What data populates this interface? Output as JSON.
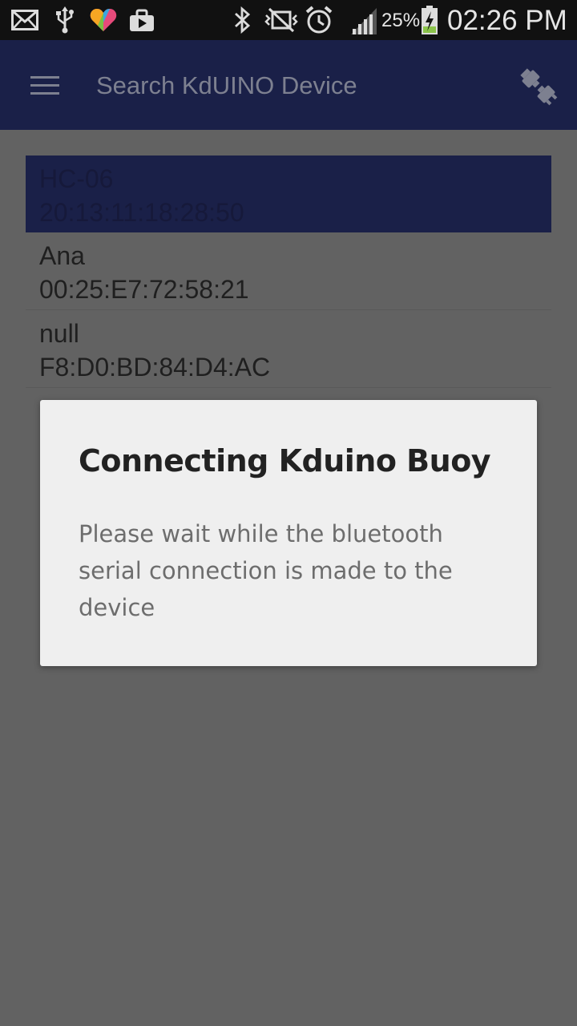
{
  "status_bar": {
    "battery_percent": "25%",
    "time": "02:26 PM",
    "icons": [
      "mail-icon",
      "usb-icon",
      "health-app-icon",
      "screenshot-icon",
      "bluetooth-icon",
      "mute-icon",
      "alarm-icon",
      "signal-icon",
      "battery-charging-icon"
    ]
  },
  "app_bar": {
    "title": "Search KdUINO Device",
    "menu_icon": "hamburger-menu-icon",
    "action_icon": "plug-connect-icon"
  },
  "devices": [
    {
      "name": "HC-06",
      "address": "20:13:11:18:28:50",
      "selected": true
    },
    {
      "name": "Ana",
      "address": "00:25:E7:72:58:21",
      "selected": false
    },
    {
      "name": "null",
      "address": "F8:D0:BD:84:D4:AC",
      "selected": false
    }
  ],
  "dialog": {
    "title": "Connecting Kduino Buoy",
    "message": "Please wait while the bluetooth serial connection is made to the device"
  },
  "colors": {
    "app_bar": "#1a2048",
    "scrim_background": "#626262",
    "dialog_background": "#efefef",
    "battery_fill": "#8bc34a"
  }
}
